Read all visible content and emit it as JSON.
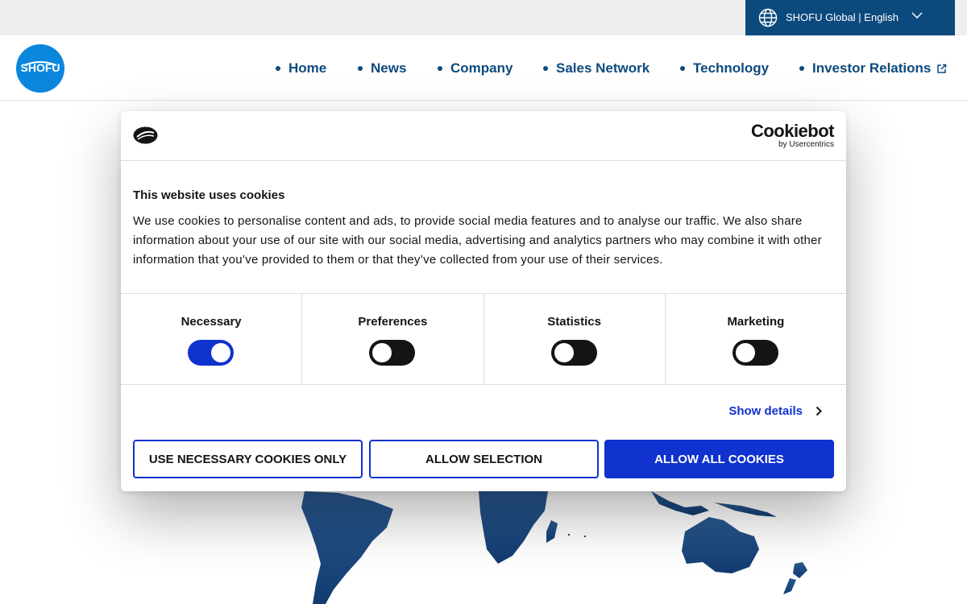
{
  "topbar": {
    "language_label": "SHOFU Global | English",
    "globe_icon": "globe-icon",
    "chevron_icon": "chevron-down-icon",
    "background_color": "#efefef",
    "language_bg_color": "#0c4a7e"
  },
  "header": {
    "logo_text": "SHOFU",
    "logo_color": "#0a86dd",
    "nav": [
      {
        "label": "Home"
      },
      {
        "label": "News"
      },
      {
        "label": "Company"
      },
      {
        "label": "Sales Network"
      },
      {
        "label": "Technology"
      },
      {
        "label": "Investor Relations",
        "icon": "external-link-icon"
      }
    ],
    "nav_color": "#0c4a7e"
  },
  "cookie_dialog": {
    "brand": {
      "name": "Cookiebot",
      "byline": "by Usercentrics",
      "mark_icon": "cookiebot-logo-icon"
    },
    "title": "This website uses cookies",
    "description": "We use cookies to personalise content and ads, to provide social media features and to analyse our traffic. We also share information about your use of our site with our social media, advertising and analytics partners who may combine it with other information that you’ve provided to them or that they’ve collected from your use of their services.",
    "categories": [
      {
        "label": "Necessary",
        "enabled": true
      },
      {
        "label": "Preferences",
        "enabled": false
      },
      {
        "label": "Statistics",
        "enabled": false
      },
      {
        "label": "Marketing",
        "enabled": false
      }
    ],
    "show_details_label": "Show details",
    "buttons": {
      "necessary_only": "USE NECESSARY COOKIES ONLY",
      "allow_selection": "ALLOW SELECTION",
      "allow_all": "ALLOW ALL COOKIES"
    },
    "accent_color": "#1032cf"
  }
}
